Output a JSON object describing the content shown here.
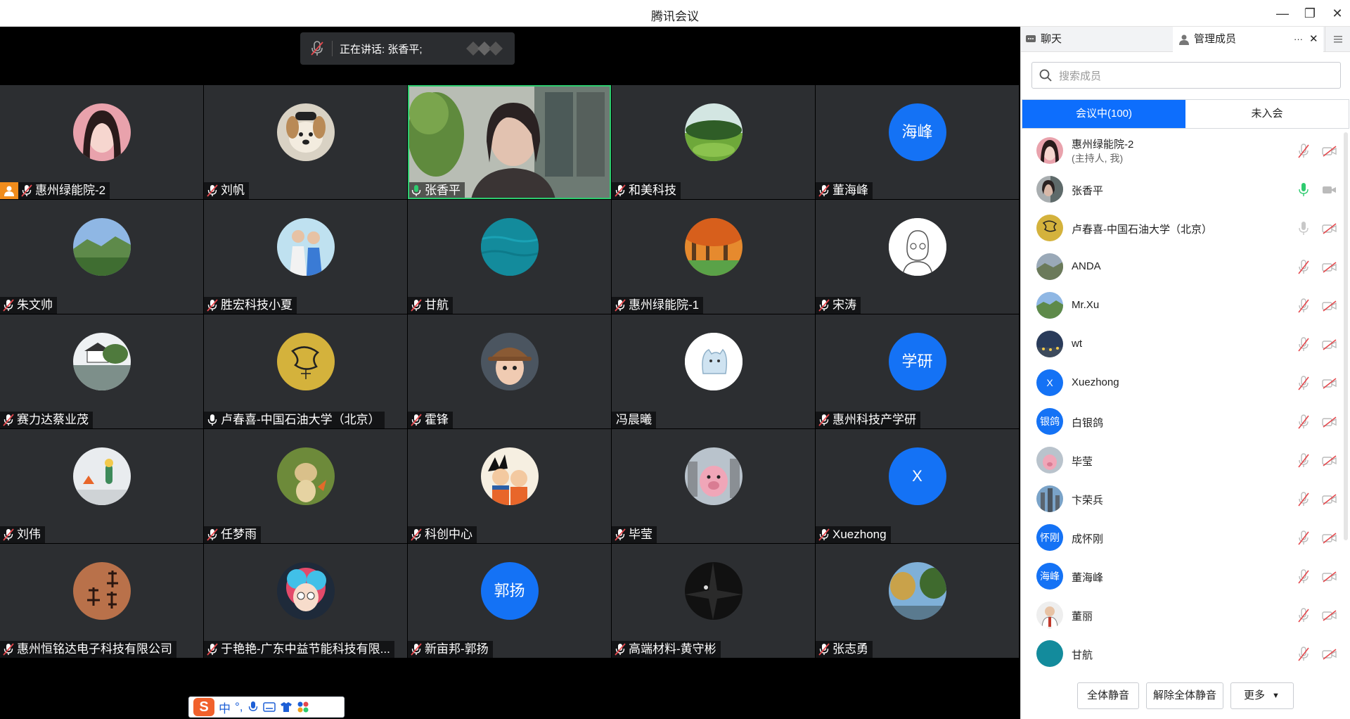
{
  "window": {
    "title": "腾讯会议",
    "minimize": "—",
    "restore": "❐",
    "close": "✕"
  },
  "speaking": {
    "text": "正在讲话: 张香平;"
  },
  "tiles": [
    {
      "name": "惠州绿能院-2",
      "host": true,
      "mic": "muted"
    },
    {
      "name": "刘帆",
      "mic": "muted"
    },
    {
      "name": "张香平",
      "mic": "active",
      "video": true
    },
    {
      "name": "和美科技",
      "mic": "muted"
    },
    {
      "name": "董海峰",
      "mic": "muted",
      "avatar_text": "海峰"
    },
    {
      "name": "朱文帅",
      "mic": "muted"
    },
    {
      "name": "胜宏科技小夏",
      "mic": "muted"
    },
    {
      "name": "甘航",
      "mic": "muted"
    },
    {
      "name": "惠州绿能院-1",
      "mic": "muted"
    },
    {
      "name": "宋涛",
      "mic": "muted"
    },
    {
      "name": "赛力达蔡业茂",
      "mic": "muted"
    },
    {
      "name": "卢春喜-中国石油大学（北京）",
      "mic": "on"
    },
    {
      "name": "霍锋",
      "mic": "muted"
    },
    {
      "name": "冯晨曦",
      "mic": "none"
    },
    {
      "name": "惠州科技产学研",
      "mic": "muted",
      "avatar_text": "学研"
    },
    {
      "name": "刘伟",
      "mic": "muted"
    },
    {
      "name": "任梦雨",
      "mic": "muted"
    },
    {
      "name": "科创中心",
      "mic": "muted"
    },
    {
      "name": "毕莹",
      "mic": "muted"
    },
    {
      "name": "Xuezhong",
      "mic": "muted",
      "avatar_text": "X"
    },
    {
      "name": "惠州恒铭达电子科技有限公司",
      "mic": "muted"
    },
    {
      "name": "于艳艳-广东中益节能科技有限...",
      "mic": "muted"
    },
    {
      "name": "新亩邦-郭扬",
      "mic": "muted",
      "avatar_text": "郭扬"
    },
    {
      "name": "高端材料-黄守彬",
      "mic": "muted"
    },
    {
      "name": "张志勇",
      "mic": "muted"
    }
  ],
  "ime": {
    "logo": "S",
    "lang": "中",
    "punct": "°,"
  },
  "panel": {
    "tab_chat": "聊天",
    "tab_members": "管理成员",
    "more": "···",
    "close": "✕",
    "search_placeholder": "搜索成员",
    "seg_in": "会议中(100)",
    "seg_out": "未入会",
    "members": [
      {
        "name": "惠州绿能院-2",
        "sub": "(主持人, 我)",
        "mic": "muted"
      },
      {
        "name": "张香平",
        "mic": "active"
      },
      {
        "name": "卢春喜-中国石油大学（北京）",
        "mic": "on"
      },
      {
        "name": "ANDA",
        "mic": "muted"
      },
      {
        "name": "Mr.Xu",
        "mic": "muted"
      },
      {
        "name": "wt",
        "mic": "muted"
      },
      {
        "name": "Xuezhong",
        "mic": "muted",
        "avatar_text": "X"
      },
      {
        "name": "白银鸽",
        "mic": "muted",
        "avatar_text": "银鸽"
      },
      {
        "name": "毕莹",
        "mic": "muted"
      },
      {
        "name": "卞荣兵",
        "mic": "muted"
      },
      {
        "name": "成怀刚",
        "mic": "muted",
        "avatar_text": "怀刚"
      },
      {
        "name": "董海峰",
        "mic": "muted",
        "avatar_text": "海峰"
      },
      {
        "name": "董丽",
        "mic": "muted"
      },
      {
        "name": "甘航",
        "mic": "muted"
      }
    ],
    "btn_mute_all": "全体静音",
    "btn_unmute_all": "解除全体静音",
    "btn_more": "更多"
  },
  "colors": {
    "accent": "#0d6efd",
    "avatar_blue": "#1472f5",
    "active_green": "#2ecb6f",
    "muted_red": "#e5484d",
    "host_orange": "#f08c1c"
  }
}
